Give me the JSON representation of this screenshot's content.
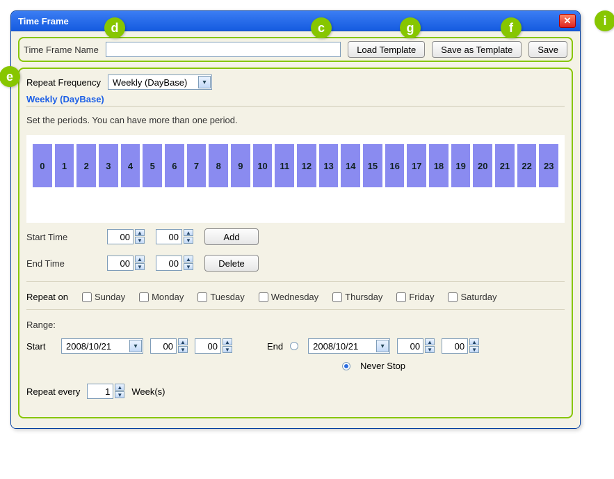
{
  "window": {
    "title": "Time Frame"
  },
  "toolbar": {
    "name_label": "Time Frame Name",
    "name_value": "",
    "load_template": "Load Template",
    "save_template": "Save as Template",
    "save": "Save"
  },
  "frequency": {
    "label": "Repeat Frequency",
    "selected": "Weekly (DayBase)"
  },
  "section": {
    "title": "Weekly (DayBase)",
    "instruction": "Set the periods. You can have more than one period."
  },
  "hours": [
    "0",
    "1",
    "2",
    "3",
    "4",
    "5",
    "6",
    "7",
    "8",
    "9",
    "10",
    "11",
    "12",
    "13",
    "14",
    "15",
    "16",
    "17",
    "18",
    "19",
    "20",
    "21",
    "22",
    "23"
  ],
  "start_time": {
    "label": "Start Time",
    "hh": "00",
    "mm": "00",
    "button": "Add"
  },
  "end_time": {
    "label": "End Time",
    "hh": "00",
    "mm": "00",
    "button": "Delete"
  },
  "repeat_on": {
    "label": "Repeat on",
    "days": [
      "Sunday",
      "Monday",
      "Tuesday",
      "Wednesday",
      "Thursday",
      "Friday",
      "Saturday"
    ]
  },
  "range": {
    "label": "Range:",
    "start_label": "Start",
    "start_date": "2008/10/21",
    "start_hh": "00",
    "start_mm": "00",
    "end_label": "End",
    "end_date": "2008/10/21",
    "end_hh": "00",
    "end_mm": "00",
    "never_stop": "Never Stop",
    "end_mode": "never"
  },
  "repeat_every": {
    "label": "Repeat every",
    "value": "1",
    "unit": "Week(s)"
  },
  "markers": {
    "d": "d",
    "c": "c",
    "g": "g",
    "f": "f",
    "i": "i",
    "e": "e"
  }
}
